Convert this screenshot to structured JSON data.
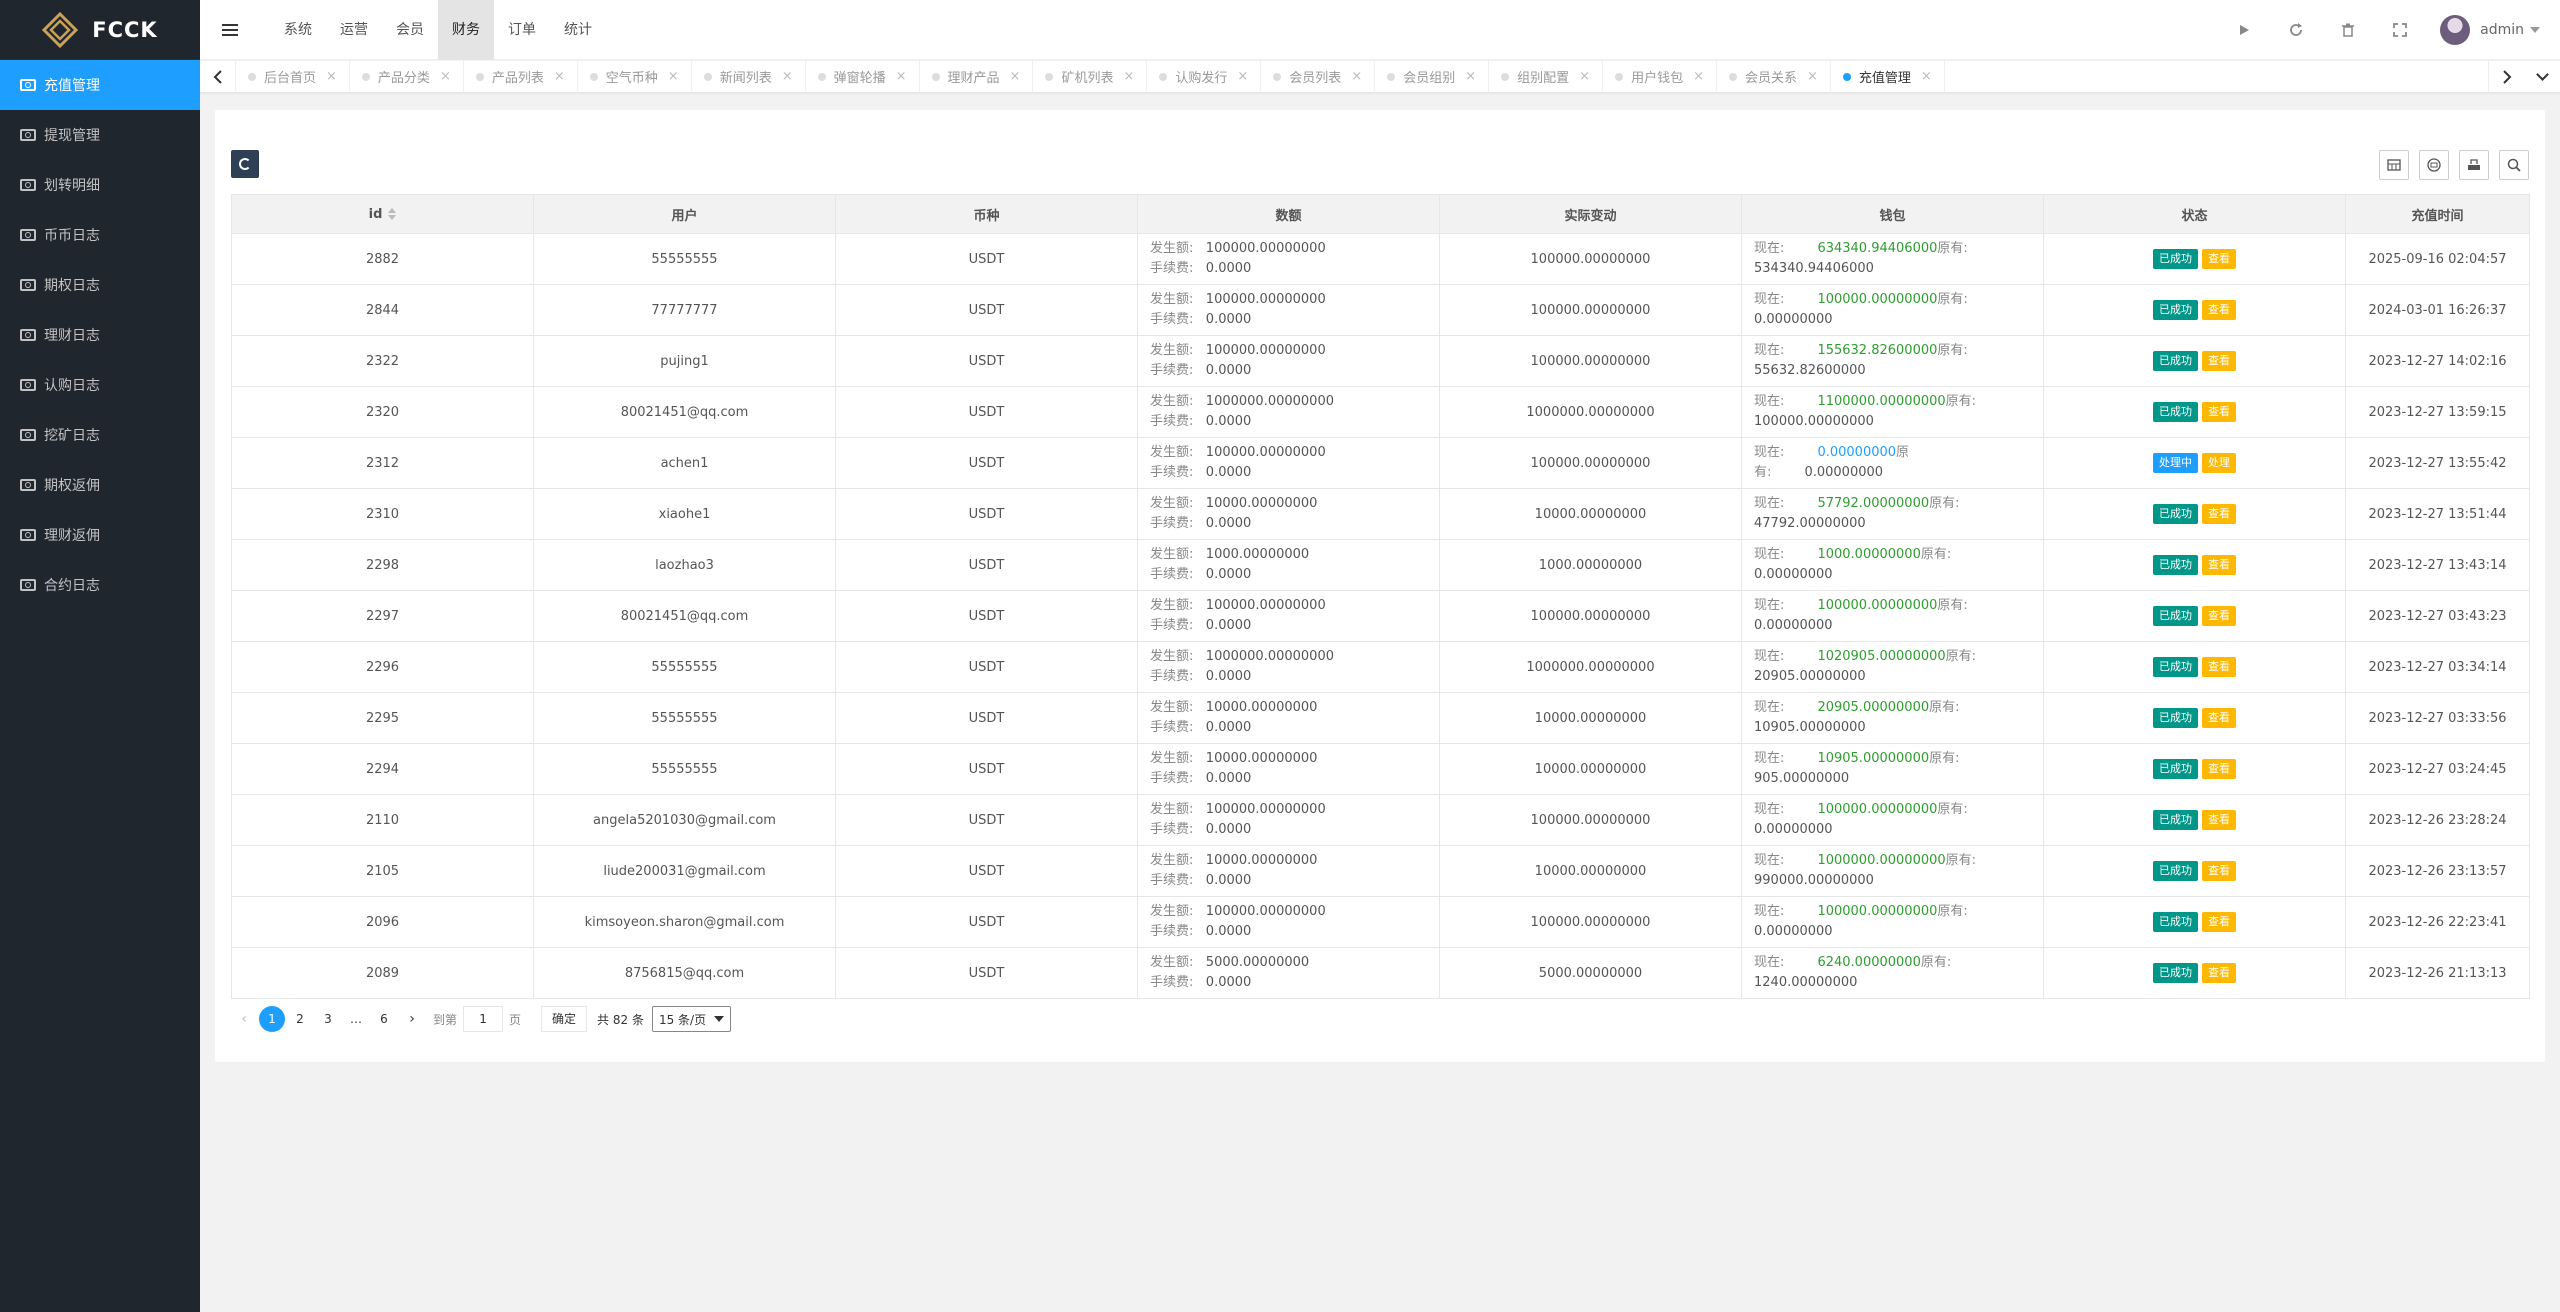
{
  "app": {
    "logo_text": "FCCK"
  },
  "sidebar": {
    "items": [
      {
        "label": "充值管理",
        "active": true
      },
      {
        "label": "提现管理"
      },
      {
        "label": "划转明细"
      },
      {
        "label": "币币日志"
      },
      {
        "label": "期权日志"
      },
      {
        "label": "理财日志"
      },
      {
        "label": "认购日志"
      },
      {
        "label": "挖矿日志"
      },
      {
        "label": "期权返佣"
      },
      {
        "label": "理财返佣"
      },
      {
        "label": "合约日志"
      }
    ]
  },
  "header": {
    "nav": [
      "系统",
      "运营",
      "会员",
      "财务",
      "订单",
      "统计"
    ],
    "active_nav": "财务",
    "user": "admin"
  },
  "tabs": [
    "后台首页",
    "产品分类",
    "产品列表",
    "空气币种",
    "新闻列表",
    "弹窗轮播",
    "理财产品",
    "矿机列表",
    "认购发行",
    "会员列表",
    "会员组别",
    "组别配置",
    "用户钱包",
    "会员关系",
    "充值管理"
  ],
  "table": {
    "headers": [
      "id",
      "用户",
      "币种",
      "数额",
      "实际变动",
      "钱包",
      "状态",
      "充值时间"
    ],
    "amount_labels": {
      "occur": "发生额:",
      "fee": "手续费:"
    },
    "wallet_labels": {
      "now": "现在:",
      "orig": "原有:"
    },
    "rows": [
      {
        "id": "2882",
        "user": "55555555",
        "coin": "USDT",
        "occur": "100000.00000000",
        "fee": "0.0000",
        "change": "100000.00000000",
        "now": "634340.94406000",
        "orig": "534340.94406000",
        "status": "已成功",
        "action": "查看",
        "time": "2025-09-16 02:04:57"
      },
      {
        "id": "2844",
        "user": "77777777",
        "coin": "USDT",
        "occur": "100000.00000000",
        "fee": "0.0000",
        "change": "100000.00000000",
        "now": "100000.00000000",
        "orig": "0.00000000",
        "status": "已成功",
        "action": "查看",
        "time": "2024-03-01 16:26:37"
      },
      {
        "id": "2322",
        "user": "pujing1",
        "coin": "USDT",
        "occur": "100000.00000000",
        "fee": "0.0000",
        "change": "100000.00000000",
        "now": "155632.82600000",
        "orig": "55632.82600000",
        "status": "已成功",
        "action": "查看",
        "time": "2023-12-27 14:02:16"
      },
      {
        "id": "2320",
        "user": "80021451@qq.com",
        "coin": "USDT",
        "occur": "1000000.00000000",
        "fee": "0.0000",
        "change": "1000000.00000000",
        "now": "1100000.00000000",
        "orig": "100000.00000000",
        "status": "已成功",
        "action": "查看",
        "time": "2023-12-27 13:59:15"
      },
      {
        "id": "2312",
        "user": "achen1",
        "coin": "USDT",
        "occur": "100000.00000000",
        "fee": "0.0000",
        "change": "100000.00000000",
        "now": "0.00000000",
        "orig": "0.00000000",
        "status": "处理中",
        "action": "处理",
        "time": "2023-12-27 13:55:42",
        "pending": true
      },
      {
        "id": "2310",
        "user": "xiaohe1",
        "coin": "USDT",
        "occur": "10000.00000000",
        "fee": "0.0000",
        "change": "10000.00000000",
        "now": "57792.00000000",
        "orig": "47792.00000000",
        "status": "已成功",
        "action": "查看",
        "time": "2023-12-27 13:51:44"
      },
      {
        "id": "2298",
        "user": "laozhao3",
        "coin": "USDT",
        "occur": "1000.00000000",
        "fee": "0.0000",
        "change": "1000.00000000",
        "now": "1000.00000000",
        "orig": "0.00000000",
        "status": "已成功",
        "action": "查看",
        "time": "2023-12-27 13:43:14"
      },
      {
        "id": "2297",
        "user": "80021451@qq.com",
        "coin": "USDT",
        "occur": "100000.00000000",
        "fee": "0.0000",
        "change": "100000.00000000",
        "now": "100000.00000000",
        "orig": "0.00000000",
        "status": "已成功",
        "action": "查看",
        "time": "2023-12-27 03:43:23"
      },
      {
        "id": "2296",
        "user": "55555555",
        "coin": "USDT",
        "occur": "1000000.00000000",
        "fee": "0.0000",
        "change": "1000000.00000000",
        "now": "1020905.00000000",
        "orig": "20905.00000000",
        "status": "已成功",
        "action": "查看",
        "time": "2023-12-27 03:34:14"
      },
      {
        "id": "2295",
        "user": "55555555",
        "coin": "USDT",
        "occur": "10000.00000000",
        "fee": "0.0000",
        "change": "10000.00000000",
        "now": "20905.00000000",
        "orig": "10905.00000000",
        "status": "已成功",
        "action": "查看",
        "time": "2023-12-27 03:33:56"
      },
      {
        "id": "2294",
        "user": "55555555",
        "coin": "USDT",
        "occur": "10000.00000000",
        "fee": "0.0000",
        "change": "10000.00000000",
        "now": "10905.00000000",
        "orig": "905.00000000",
        "status": "已成功",
        "action": "查看",
        "time": "2023-12-27 03:24:45"
      },
      {
        "id": "2110",
        "user": "angela5201030@gmail.com",
        "coin": "USDT",
        "occur": "100000.00000000",
        "fee": "0.0000",
        "change": "100000.00000000",
        "now": "100000.00000000",
        "orig": "0.00000000",
        "status": "已成功",
        "action": "查看",
        "time": "2023-12-26 23:28:24"
      },
      {
        "id": "2105",
        "user": "liude200031@gmail.com",
        "coin": "USDT",
        "occur": "10000.00000000",
        "fee": "0.0000",
        "change": "10000.00000000",
        "now": "1000000.00000000",
        "orig": "990000.00000000",
        "status": "已成功",
        "action": "查看",
        "time": "2023-12-26 23:13:57"
      },
      {
        "id": "2096",
        "user": "kimsoyeon.sharon@gmail.com",
        "coin": "USDT",
        "occur": "100000.00000000",
        "fee": "0.0000",
        "change": "100000.00000000",
        "now": "100000.00000000",
        "orig": "0.00000000",
        "status": "已成功",
        "action": "查看",
        "time": "2023-12-26 22:23:41"
      },
      {
        "id": "2089",
        "user": "8756815@qq.com",
        "coin": "USDT",
        "occur": "5000.00000000",
        "fee": "0.0000",
        "change": "5000.00000000",
        "now": "6240.00000000",
        "orig": "1240.00000000",
        "status": "已成功",
        "action": "查看",
        "time": "2023-12-26 21:13:13"
      }
    ]
  },
  "pagination": {
    "current": "1",
    "pages": [
      "1",
      "2",
      "3",
      "…",
      "6"
    ],
    "goto_label": "到第",
    "goto_value": "1",
    "page_unit": "页",
    "confirm": "确定",
    "total": "共 82 条",
    "per_page": "15 条/页"
  },
  "colors": {
    "accent": "#1e9fff",
    "sidebar_bg": "#20262e",
    "success": "#009688",
    "view": "#ffb800"
  }
}
